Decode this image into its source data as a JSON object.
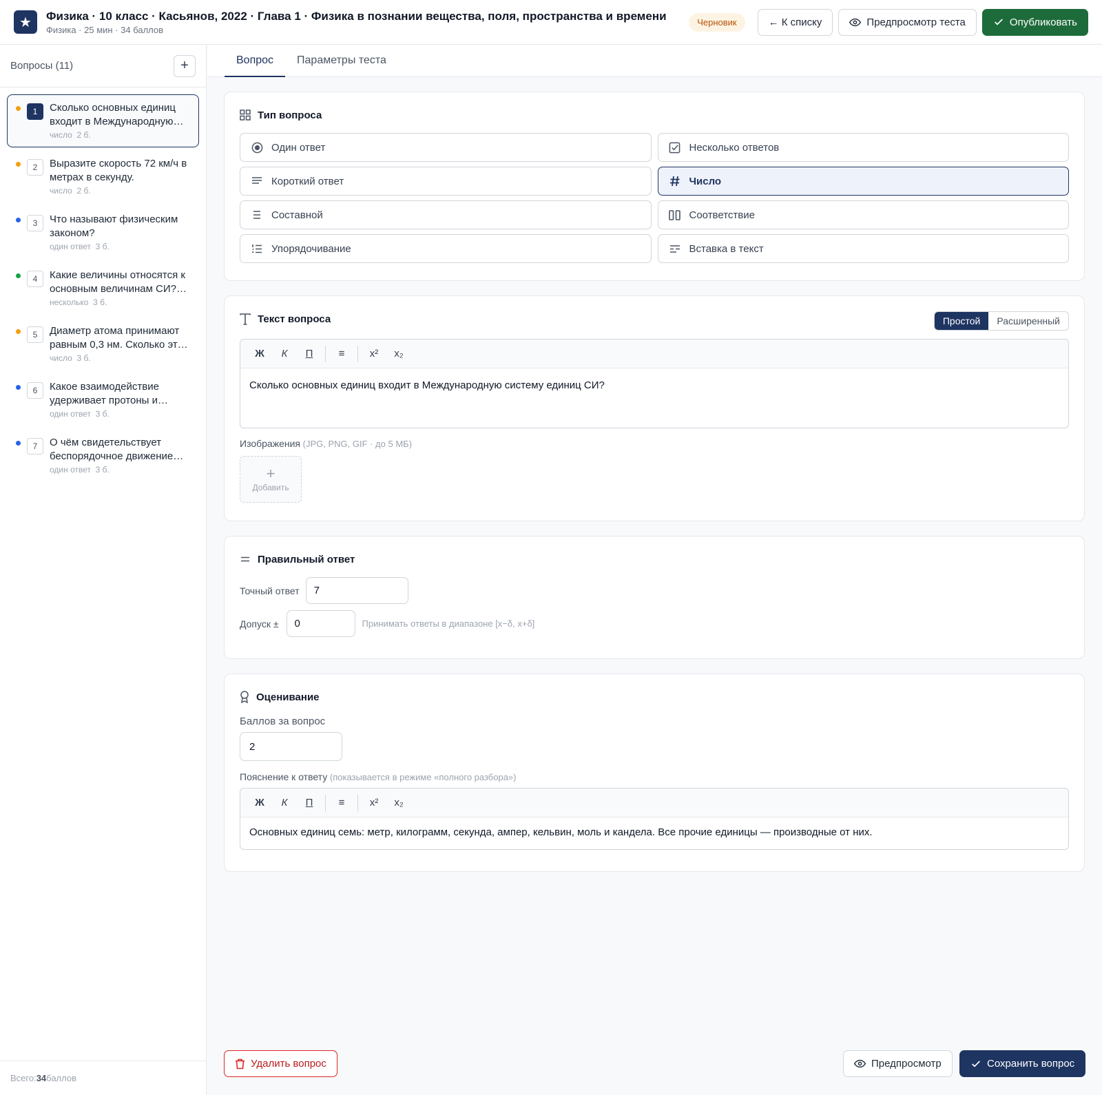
{
  "header": {
    "logo_glyph": "★",
    "title": "Физика · 10 класс · Касьянов, 2022 · Глава 1 · Физика в познании вещества, поля, пространства и времени",
    "subtitle": "Физика · 25 мин · 34 баллов",
    "status_badge": "Черновик",
    "back_button": "← К списку",
    "preview_test_button": "Предпросмотр теста",
    "publish_button": "Опубликовать"
  },
  "sidebar": {
    "title": "Вопросы (11)",
    "add_glyph": "+",
    "items": [
      {
        "num": "1",
        "text": "Сколько основных единиц входит в Международную систему единиц СИ?",
        "type": "число",
        "points": "2 б.",
        "dot_color": "#f59e0b"
      },
      {
        "num": "2",
        "text": "Выразите скорость 72 км/ч в метрах в секунду.",
        "type": "число",
        "points": "2 б.",
        "dot_color": "#f59e0b"
      },
      {
        "num": "3",
        "text": "Что называют физическим законом?",
        "type": "один ответ",
        "points": "3 б.",
        "dot_color": "#2563eb"
      },
      {
        "num": "4",
        "text": "Какие величины относятся к основным величинам СИ? Выберите все верные.",
        "type": "несколько",
        "points": "3 б.",
        "dot_color": "#16a34a"
      },
      {
        "num": "5",
        "text": "Диаметр атома принимают равным 0,3 нм. Сколько это в метрах?",
        "type": "число",
        "points": "3 б.",
        "dot_color": "#f59e0b"
      },
      {
        "num": "6",
        "text": "Какое взаимодействие удерживает протоны и нейтроны в ядре?",
        "type": "один ответ",
        "points": "3 б.",
        "dot_color": "#2563eb"
      },
      {
        "num": "7",
        "text": "О чём свидетельствует беспорядочное движение частиц?",
        "type": "один ответ",
        "points": "3 б.",
        "dot_color": "#2563eb"
      }
    ],
    "footer_prefix": "Всего: ",
    "footer_total": "34",
    "footer_suffix": " баллов"
  },
  "tabs": [
    {
      "label": "Вопрос"
    },
    {
      "label": "Параметры теста"
    }
  ],
  "question_type": {
    "title": "Тип вопроса",
    "options": [
      {
        "label": "Один ответ",
        "icon": "radio-icon"
      },
      {
        "label": "Несколько ответов",
        "icon": "checkbox-icon"
      },
      {
        "label": "Короткий ответ",
        "icon": "text-lines-icon"
      },
      {
        "label": "Число",
        "icon": "hash-icon"
      },
      {
        "label": "Составной",
        "icon": "list-icon"
      },
      {
        "label": "Соответствие",
        "icon": "columns-icon"
      },
      {
        "label": "Упорядочивание",
        "icon": "ordered-list-icon"
      },
      {
        "label": "Вставка в текст",
        "icon": "text-insert-icon"
      }
    ],
    "selected": "Число"
  },
  "question_text": {
    "title": "Текст вопроса",
    "mode_simple": "Простой",
    "mode_advanced": "Расширенный",
    "toolbar": {
      "bold": "Ж",
      "italic": "К",
      "underline": "П",
      "list": "≡",
      "sup": "x²",
      "sub": "x₂"
    },
    "value": "Сколько основных единиц входит в Международную систему единиц СИ?",
    "images_label": "Изображения",
    "images_hint": " (JPG, PNG, GIF · до 5 МБ)",
    "add_image_glyph": "+",
    "add_image_label": "Добавить"
  },
  "correct_answer": {
    "title": "Правильный ответ",
    "exact_label": "Точный ответ",
    "exact_value": "7",
    "tolerance_label": "Допуск ±",
    "tolerance_value": "0",
    "tolerance_hint": "Принимать ответы в диапазоне [x−δ, x+δ]"
  },
  "grading": {
    "title": "Оценивание",
    "points_label": "Баллов за вопрос",
    "points_value": "2",
    "explanation_label": "Пояснение к ответу",
    "explanation_hint": " (показывается в режиме «полного разбора»)",
    "toolbar": {
      "bold": "Ж",
      "italic": "К",
      "underline": "П",
      "list": "≡",
      "sup": "x²",
      "sub": "x₂"
    },
    "explanation_value": "Основных единиц семь: метр, килограмм, секунда, ампер, кельвин, моль и кандела. Все прочие единицы — производные от них."
  },
  "footer": {
    "delete_button": "Удалить вопрос",
    "preview_button": "Предпросмотр",
    "save_button": "Сохранить вопрос"
  },
  "colors": {
    "brand": "#1e3461",
    "publish": "#1d6b3a",
    "danger": "#dc2626"
  }
}
